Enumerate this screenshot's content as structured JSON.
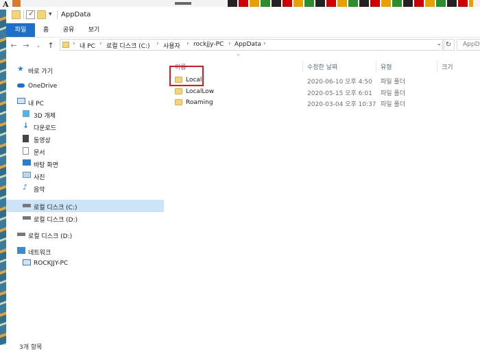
{
  "window": {
    "title": "AppData"
  },
  "ribbon": {
    "tabs": [
      "파일",
      "홈",
      "공유",
      "보기"
    ]
  },
  "address": {
    "crumbs": [
      "내 PC",
      "로컬 디스크 (C:)",
      "사용자",
      "rockjjy-PC",
      "AppData"
    ],
    "search_placeholder": "AppDa"
  },
  "columns": {
    "name": "이름",
    "date": "수정한 날짜",
    "type": "유형",
    "size": "크기"
  },
  "sidebar": {
    "items": [
      {
        "label": "바로 가기",
        "icon": "star-icon"
      },
      {
        "label": "OneDrive",
        "icon": "cloud-icon"
      },
      {
        "label": "내 PC",
        "icon": "pc-icon"
      },
      {
        "label": "3D 개체",
        "icon": "cube-icon"
      },
      {
        "label": "다운로드",
        "icon": "download-icon"
      },
      {
        "label": "동영상",
        "icon": "video-icon"
      },
      {
        "label": "문서",
        "icon": "document-icon"
      },
      {
        "label": "바탕 화면",
        "icon": "desktop-icon"
      },
      {
        "label": "사진",
        "icon": "picture-icon"
      },
      {
        "label": "음악",
        "icon": "music-icon"
      },
      {
        "label": "로컬 디스크 (C:)",
        "icon": "drive-icon"
      },
      {
        "label": "로컬 디스크 (D:)",
        "icon": "drive-icon"
      },
      {
        "label": "로컬 디스크 (D:)",
        "icon": "drive-icon"
      },
      {
        "label": "네트워크",
        "icon": "network-icon"
      },
      {
        "label": "ROCKJJY-PC",
        "icon": "computer-icon"
      }
    ],
    "selected": "로컬 디스크 (C:)"
  },
  "files": [
    {
      "name": "Local",
      "date": "2020-06-10 오후 4:50",
      "type": "파일 폴더"
    },
    {
      "name": "LocalLow",
      "date": "2020-05-15 오후 6:01",
      "type": "파일 폴더"
    },
    {
      "name": "Roaming",
      "date": "2020-03-04 오후 10:37",
      "type": "파일 폴더"
    }
  ],
  "status": {
    "count": "3개 항목"
  },
  "colors": {
    "accent": "#1e6fc9",
    "selected_bg": "#cce4f7",
    "highlight": "#e3141c"
  }
}
